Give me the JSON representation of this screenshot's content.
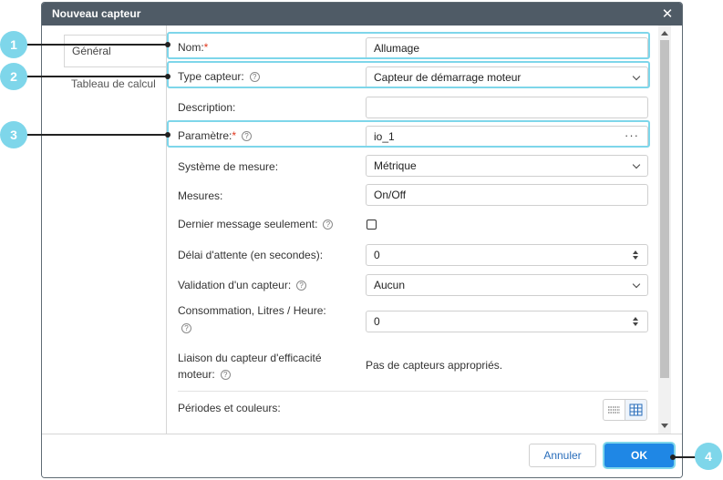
{
  "window": {
    "title": "Nouveau capteur",
    "close_label": "✕"
  },
  "tabs": [
    {
      "label": "Général",
      "active": true
    },
    {
      "label": "Tableau de calcul",
      "active": false
    }
  ],
  "form": {
    "name_label": "Nom:",
    "name_required": "*",
    "name_value": "Allumage",
    "type_label": "Type capteur:",
    "type_value": "Capteur de démarrage moteur",
    "description_label": "Description:",
    "description_value": "",
    "param_label": "Paramètre:",
    "param_required": "*",
    "param_value": "io_1",
    "param_dots": "···",
    "measure_system_label": "Système de mesure:",
    "measure_system_value": "Métrique",
    "measures_label": "Mesures:",
    "measures_value": "On/Off",
    "last_msg_label": "Dernier message seulement:",
    "last_msg_checked": false,
    "timeout_label": "Délai d'attente (en secondes):",
    "timeout_value": "0",
    "validation_label": "Validation d'un capteur:",
    "validation_value": "Aucun",
    "consumption_label": "Consommation, Litres / Heure:",
    "consumption_value": "0",
    "efficiency_label_line1": "Liaison du capteur d'efficacité",
    "efficiency_label_line2": "moteur:",
    "efficiency_value": "Pas de capteurs appropriés.",
    "periods_label": "Périodes et couleurs:"
  },
  "footer": {
    "cancel_label": "Annuler",
    "ok_label": "OK"
  },
  "callouts": [
    "1",
    "2",
    "3",
    "4"
  ],
  "colors": {
    "highlight": "#7ed6ea",
    "titlebar": "#4f5b66",
    "ok_button": "#1f87e5",
    "required": "#e0361c"
  }
}
